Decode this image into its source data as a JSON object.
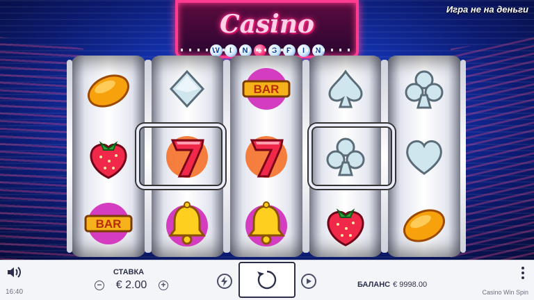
{
  "game": {
    "logo_top": "Casino",
    "logo_bottom_letters": [
      "W",
      "I",
      "N",
      "♠",
      "S",
      "P",
      "I",
      "N"
    ],
    "free_play_notice": "Игра не на деньги"
  },
  "reels": [
    [
      "orange",
      "strawberry",
      "bar"
    ],
    [
      "diamond",
      "seven",
      "bell"
    ],
    [
      "bar",
      "seven",
      "bell"
    ],
    [
      "spade",
      "club",
      "strawberry"
    ],
    [
      "club",
      "heart",
      "orange"
    ]
  ],
  "toolbar": {
    "stake_label": "СТАВКА",
    "stake_value": "€ 2.00",
    "stake_minus": "−",
    "stake_plus": "+",
    "balance_label": "БАЛАНС",
    "balance_value": "€ 9998.00",
    "time": "16:40",
    "game_name": "Casino Win Spin"
  },
  "colors": {
    "background": "#1536b8",
    "marquee": "#ff3c8f",
    "toolbar": "#f4f5f9"
  }
}
